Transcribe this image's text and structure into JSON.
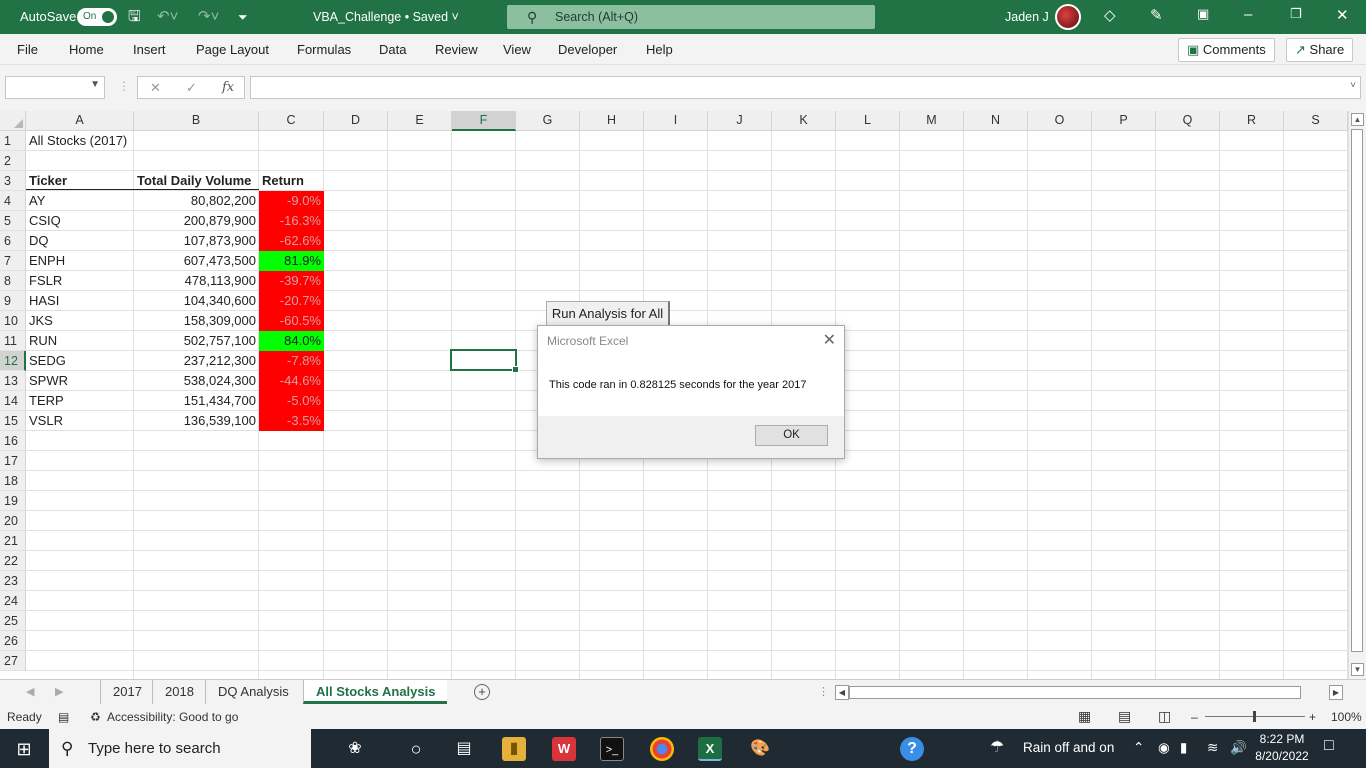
{
  "titlebar": {
    "autosave_label": "AutoSave",
    "autosave_state": "On",
    "document_name": "VBA_Challenge • Saved",
    "search_placeholder": "Search (Alt+Q)",
    "user_name": "Jaden J",
    "accent_color": "#217346"
  },
  "menu": {
    "items": [
      "File",
      "Home",
      "Insert",
      "Page Layout",
      "Formulas",
      "Data",
      "Review",
      "View",
      "Developer",
      "Help"
    ],
    "comments_label": "Comments",
    "share_label": "Share"
  },
  "formula_bar": {
    "name_box": "",
    "formula": "",
    "fx_label": "fx"
  },
  "grid": {
    "columns": [
      "A",
      "B",
      "C",
      "D",
      "E",
      "F",
      "G",
      "H",
      "I",
      "J",
      "K",
      "L",
      "M",
      "N",
      "O",
      "P",
      "Q",
      "R",
      "S"
    ],
    "active_column": "F",
    "active_row": "12",
    "rows": [
      "1",
      "2",
      "3",
      "4",
      "5",
      "6",
      "7",
      "8",
      "9",
      "10",
      "11",
      "12",
      "13",
      "14",
      "15",
      "16",
      "17",
      "18",
      "19",
      "20",
      "21",
      "22",
      "23",
      "24",
      "25",
      "26",
      "27"
    ],
    "title_cell": "All Stocks (2017)",
    "headers": [
      "Ticker",
      "Total Daily Volume",
      "Return"
    ],
    "stocks": [
      {
        "ticker": "AY",
        "volume": "80,802,200",
        "return": "-9.0%",
        "positive": false
      },
      {
        "ticker": "CSIQ",
        "volume": "200,879,900",
        "return": "-16.3%",
        "positive": false
      },
      {
        "ticker": "DQ",
        "volume": "107,873,900",
        "return": "-62.6%",
        "positive": false
      },
      {
        "ticker": "ENPH",
        "volume": "607,473,500",
        "return": "81.9%",
        "positive": true
      },
      {
        "ticker": "FSLR",
        "volume": "478,113,900",
        "return": "-39.7%",
        "positive": false
      },
      {
        "ticker": "HASI",
        "volume": "104,340,600",
        "return": "-20.7%",
        "positive": false
      },
      {
        "ticker": "JKS",
        "volume": "158,309,000",
        "return": "-60.5%",
        "positive": false
      },
      {
        "ticker": "RUN",
        "volume": "502,757,100",
        "return": "84.0%",
        "positive": true
      },
      {
        "ticker": "SEDG",
        "volume": "237,212,300",
        "return": "-7.8%",
        "positive": false
      },
      {
        "ticker": "SPWR",
        "volume": "538,024,300",
        "return": "-44.6%",
        "positive": false
      },
      {
        "ticker": "TERP",
        "volume": "151,434,700",
        "return": "-5.0%",
        "positive": false
      },
      {
        "ticker": "VSLR",
        "volume": "136,539,100",
        "return": "-3.5%",
        "positive": false
      }
    ],
    "negative_color": "#ff0000",
    "positive_color": "#00ff00"
  },
  "run_button_label": "Run Analysis for All",
  "dialog": {
    "title": "Microsoft Excel",
    "message": "This code ran in 0.828125 seconds for the year 2017",
    "ok_label": "OK"
  },
  "sheets": {
    "tabs": [
      "2017",
      "2018",
      "DQ Analysis",
      "All Stocks Analysis"
    ],
    "active": "All Stocks Analysis"
  },
  "status": {
    "ready": "Ready",
    "accessibility": "Accessibility: Good to go",
    "zoom": "100%"
  },
  "taskbar": {
    "search_placeholder": "Type here to search",
    "weather": "Rain off and on",
    "time": "8:22 PM",
    "date": "8/20/2022"
  }
}
